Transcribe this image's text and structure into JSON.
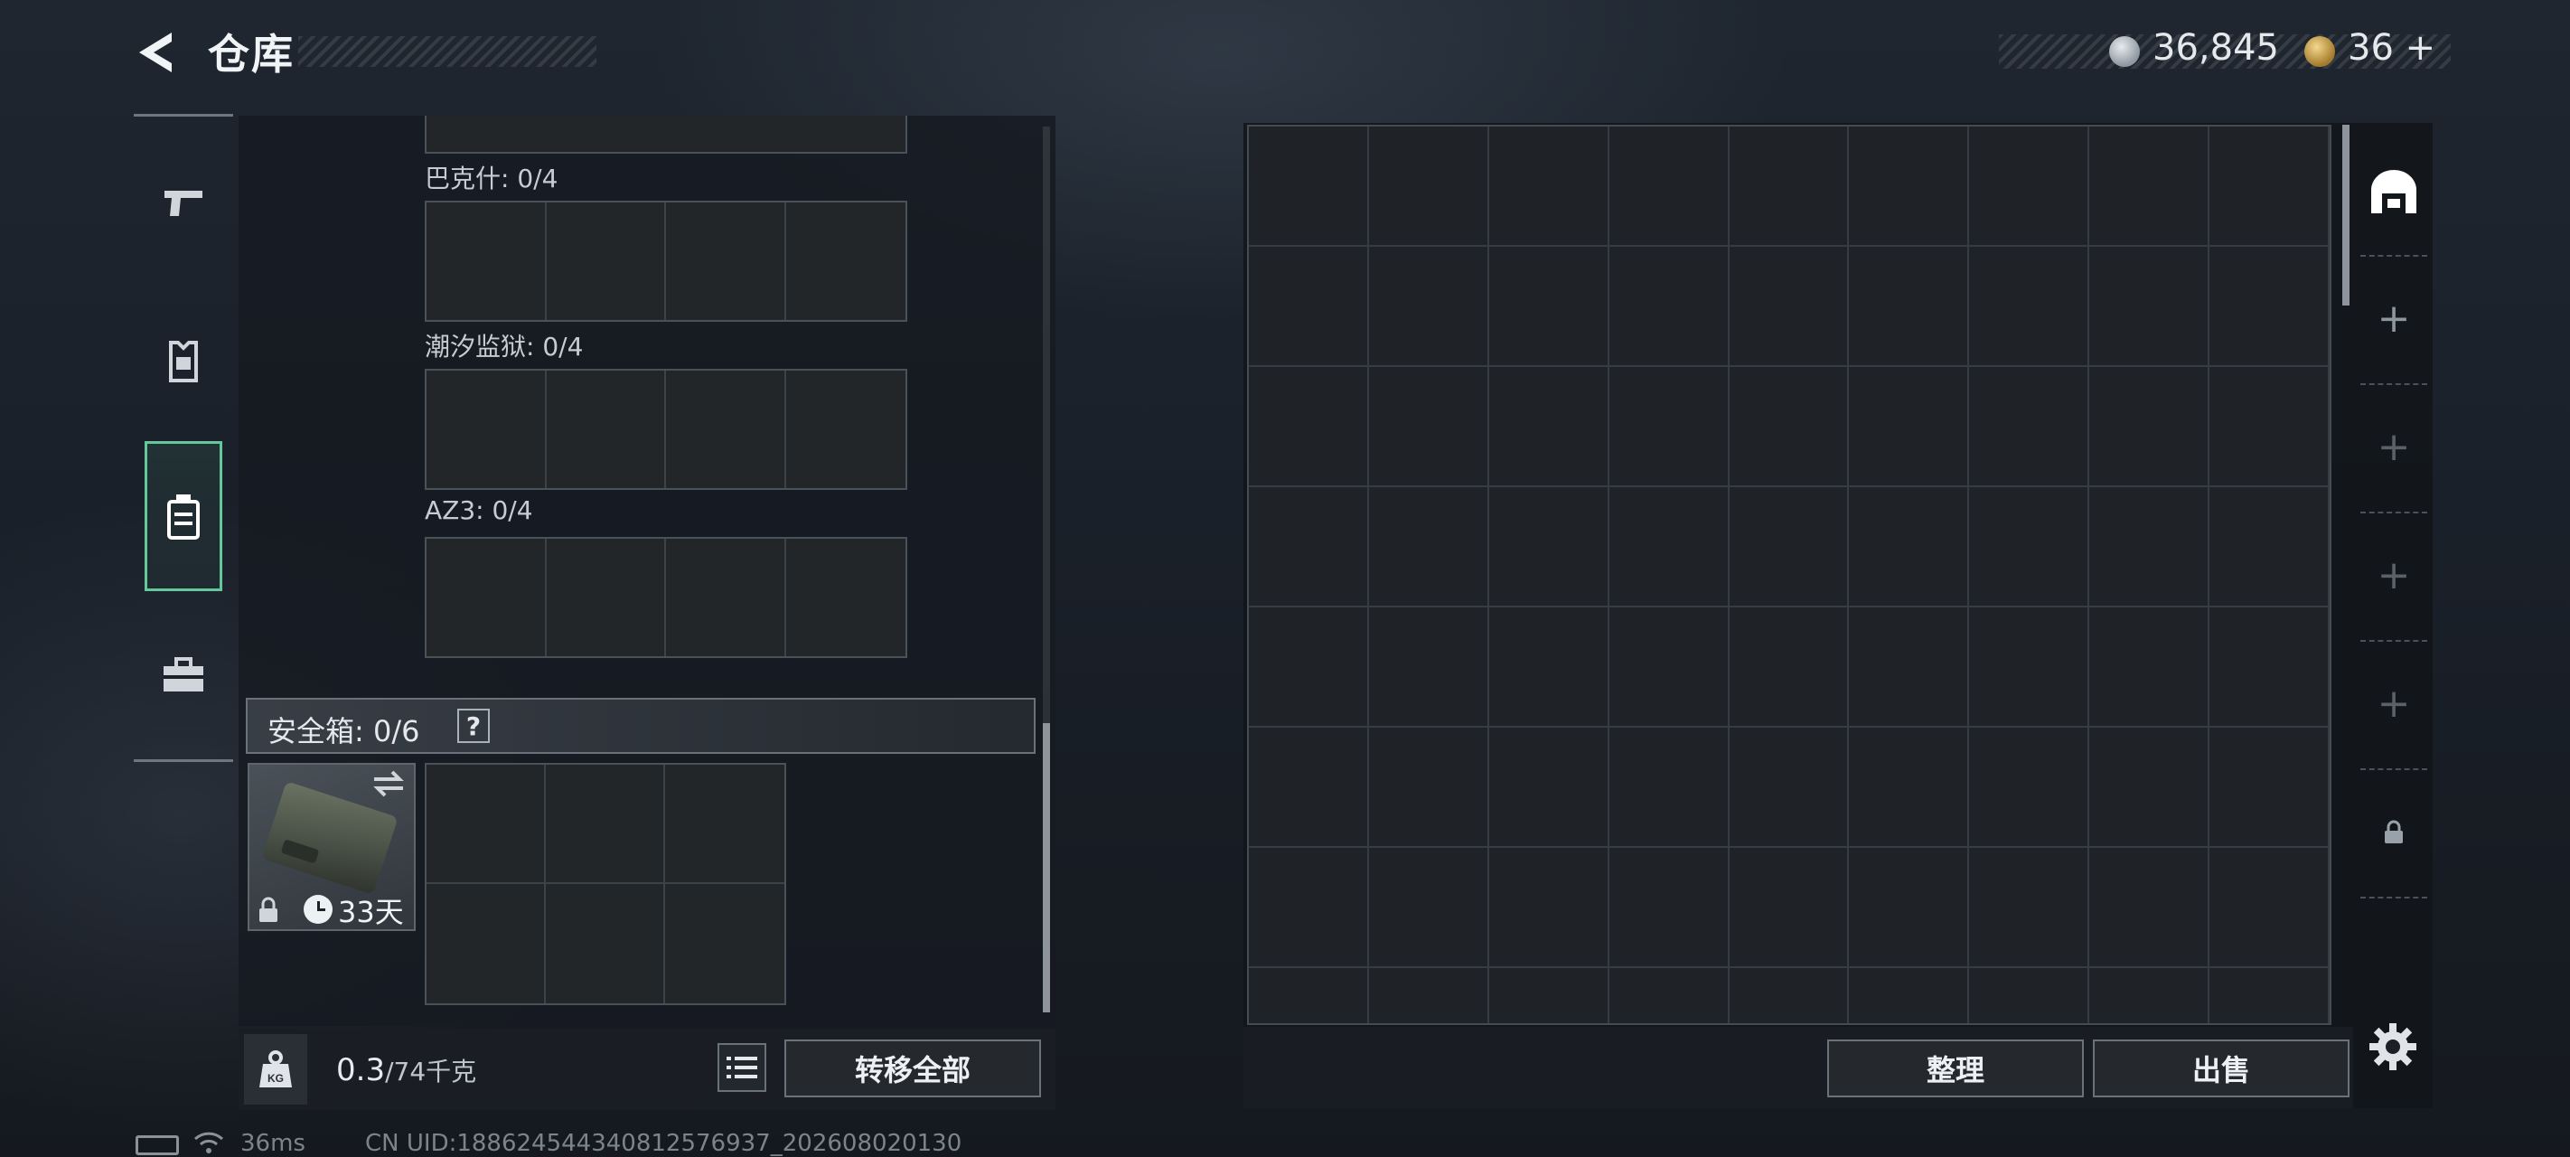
{
  "header": {
    "title": "仓库",
    "back_icon": "back-arrow-icon"
  },
  "currency": {
    "silver_value": "36,845",
    "gold_value": "36",
    "gold_add": "+"
  },
  "nav": {
    "items": [
      {
        "name": "weapons",
        "icon": "pistol-icon"
      },
      {
        "name": "armor",
        "icon": "vest-icon"
      },
      {
        "name": "backpack",
        "icon": "backpack-icon",
        "active": true
      },
      {
        "name": "toolbox",
        "icon": "toolbox-icon"
      }
    ]
  },
  "container_slots": [
    {
      "label": "巴克什: 0/4",
      "cells": 4
    },
    {
      "label": "潮汐监狱: 0/4",
      "cells": 4
    },
    {
      "label": "AZ3: 0/4",
      "cells": 4
    }
  ],
  "safe_box": {
    "label": "安全箱:  0/6",
    "help": "?",
    "days_left": "33天",
    "cells": 6
  },
  "weight": {
    "current": "0.3",
    "max": "/74千克"
  },
  "buttons": {
    "transfer_all": "转移全部",
    "sort": "整理",
    "sell": "出售"
  },
  "storage": {
    "columns": 9,
    "rows": 8
  },
  "side_tabs": {
    "plus_symbol": "+"
  },
  "status": {
    "ping": "36ms",
    "uid": "CN UID:1886245443408125769​37_202608020130"
  },
  "colors": {
    "accent_active": "#65c89a",
    "panel_bg": "#16191f",
    "grid_line": "#363c42"
  }
}
